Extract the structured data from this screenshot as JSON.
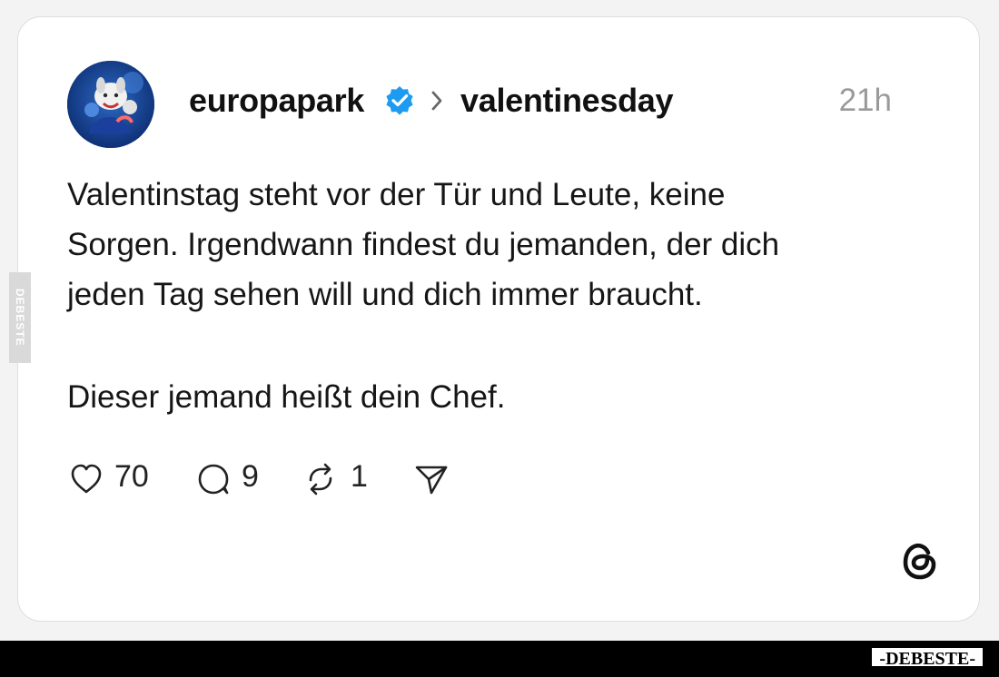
{
  "post": {
    "username": "europapark",
    "topic": "valentinesday",
    "timestamp": "21h",
    "text_lines": [
      "Valentinstag steht vor der Tür und Leute, keine",
      "Sorgen. Irgendwann findest du jemanden, der dich",
      "jeden Tag sehen will und dich immer braucht.",
      "Dieser jemand heißt dein Chef."
    ]
  },
  "actions": {
    "likes": "70",
    "replies": "9",
    "reposts": "1"
  },
  "icons": {
    "avatar": "avatar",
    "verified": "verified-badge-icon",
    "chevron": "chevron-right-icon",
    "like": "heart-icon",
    "reply": "speech-bubble-icon",
    "repost": "repost-icon",
    "share": "send-icon",
    "platform": "threads-logo-icon"
  },
  "watermark": {
    "side": "DEBESTE",
    "bottom": "-DEBESTE-"
  },
  "colors": {
    "verified_badge": "#1d9bf0",
    "timestamp": "#9a9a9a",
    "footer": "#000000"
  }
}
